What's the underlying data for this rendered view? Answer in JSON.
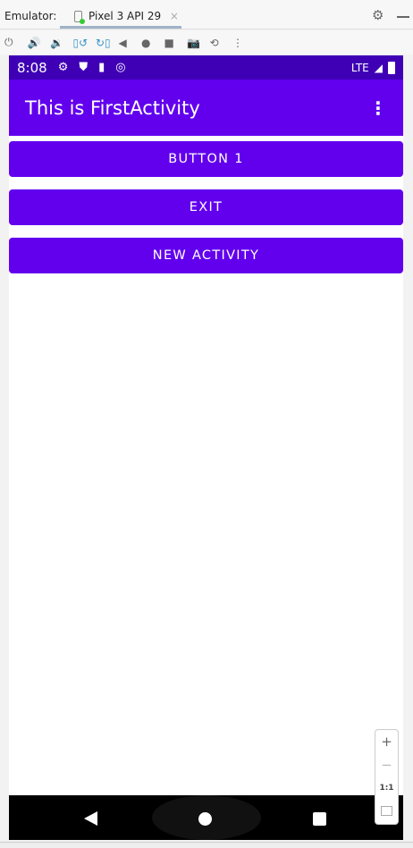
{
  "ide": {
    "emulator_label": "Emulator:",
    "tab_label": "Pixel 3 API 29",
    "close": "×"
  },
  "toolbar": [
    {
      "icon": "power-icon",
      "glyph": "⏻"
    },
    {
      "icon": "volume-up-icon",
      "glyph": "🔊"
    },
    {
      "icon": "volume-down-icon",
      "glyph": "🔉"
    },
    {
      "icon": "rotate-left-icon",
      "glyph": "▯↺"
    },
    {
      "icon": "rotate-right-icon",
      "glyph": "↻▯"
    },
    {
      "icon": "back-icon",
      "glyph": "◀"
    },
    {
      "icon": "home-icon",
      "glyph": "●"
    },
    {
      "icon": "overview-icon",
      "glyph": "■"
    },
    {
      "icon": "camera-icon",
      "glyph": "📷"
    },
    {
      "icon": "snapshot-icon",
      "glyph": "⟲"
    },
    {
      "icon": "more-icon",
      "glyph": "⋮"
    }
  ],
  "status": {
    "time": "8:08",
    "network": "LTE"
  },
  "app": {
    "title": "This is FirstActivity",
    "buttons": [
      "BUTTON 1",
      "EXIT",
      "NEW ACTIVITY"
    ]
  },
  "zoom": {
    "in": "+",
    "out": "−",
    "actual": "1:1"
  },
  "colors": {
    "status": "#3f00b5",
    "primary": "#6200ee"
  }
}
